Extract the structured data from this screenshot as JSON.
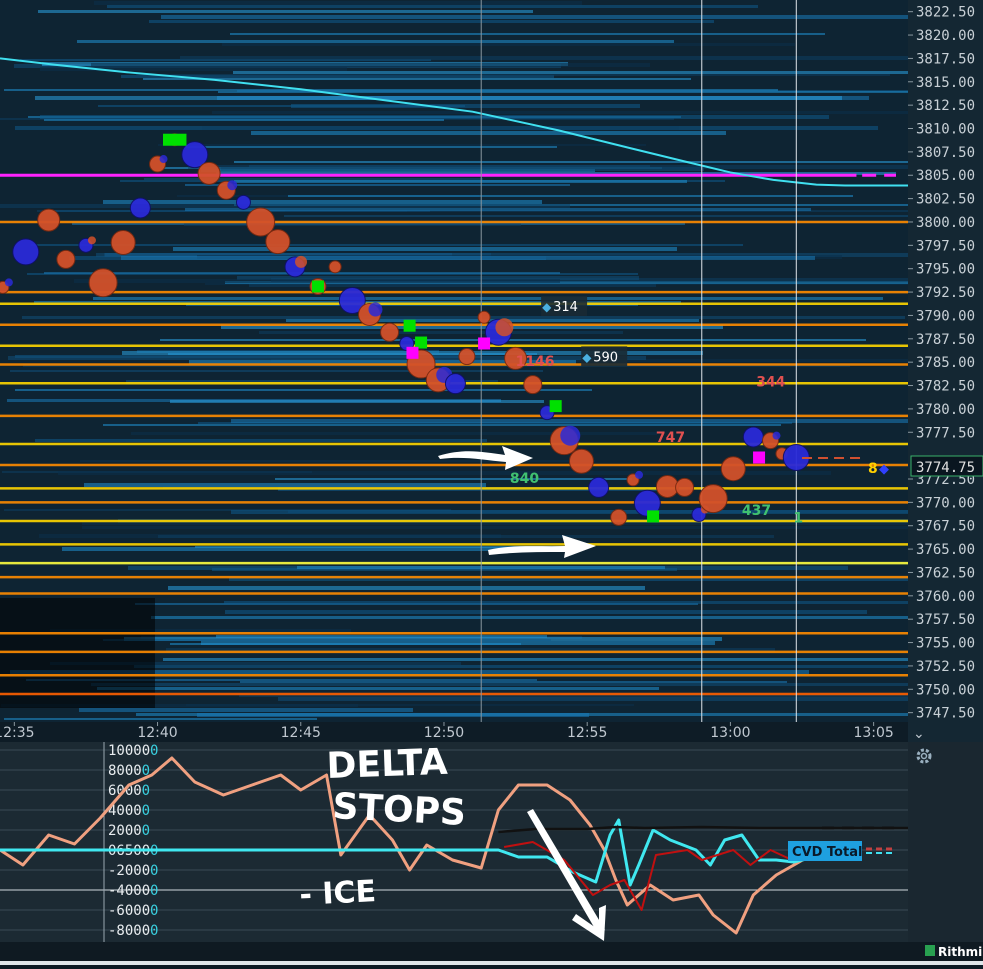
{
  "app": {
    "brand_label": "Rithmi",
    "settings_icon": "gear-icon",
    "collapse_icon": "chevron-down-icon"
  },
  "colors": {
    "background": "#0c1a24",
    "ask_bubble": "#d2512a",
    "bid_bubble": "#2a2ad8",
    "vwap_line": "#40e0f0",
    "magenta_level": "#ff22ff",
    "cvd_line": "#f0a080",
    "delta_line": "#40e8f0",
    "stops_line": "#c01010",
    "ice_line": "#111111",
    "annotation_ink": "#ffffff"
  },
  "chart_data": [
    {
      "type": "heatmap",
      "panel": "price",
      "xlabel": "",
      "ylabel": "",
      "x_ticks": [
        "12:35",
        "12:40",
        "12:45",
        "12:50",
        "12:55",
        "13:00",
        "13:05"
      ],
      "y_ticks": [
        "3822.50",
        "3820.00",
        "3817.50",
        "3815.00",
        "3812.50",
        "3810.00",
        "3807.50",
        "3805.00",
        "3802.50",
        "3800.00",
        "3797.50",
        "3795.00",
        "3792.50",
        "3790.00",
        "3787.50",
        "3785.00",
        "3782.50",
        "3780.00",
        "3777.50",
        "3774.75",
        "3772.50",
        "3770.00",
        "3767.50",
        "3765.00",
        "3762.50",
        "3760.00",
        "3757.50",
        "3755.00",
        "3752.50",
        "3750.00",
        "3747.50"
      ],
      "ylim": [
        3746.5,
        3823.75
      ],
      "xlim_minutes": [
        34.5,
        66.2
      ],
      "current_price": "3774.75",
      "current_price_marker": "8",
      "magenta_level": 3805.0,
      "vwap": {
        "name": "",
        "points": [
          [
            34.5,
            3817.5
          ],
          [
            36.5,
            3816.8
          ],
          [
            39,
            3816.0
          ],
          [
            42,
            3815.2
          ],
          [
            45,
            3814.2
          ],
          [
            48,
            3813.0
          ],
          [
            51,
            3811.8
          ],
          [
            54,
            3809.8
          ],
          [
            56.5,
            3807.9
          ],
          [
            58.5,
            3806.4
          ],
          [
            60,
            3805.3
          ],
          [
            61.5,
            3804.5
          ],
          [
            63,
            3804.0
          ],
          [
            64,
            3803.9
          ],
          [
            66.2,
            3803.9
          ]
        ]
      },
      "price_path": [
        [
          34.6,
          3793.0
        ],
        [
          35.4,
          3796.8
        ],
        [
          36.2,
          3800.2
        ],
        [
          36.8,
          3796.0
        ],
        [
          37.5,
          3797.5
        ],
        [
          38.1,
          3793.5
        ],
        [
          38.8,
          3797.8
        ],
        [
          39.4,
          3801.5
        ],
        [
          40.0,
          3806.2
        ],
        [
          40.6,
          3808.8
        ],
        [
          41.3,
          3807.2
        ],
        [
          41.8,
          3805.2
        ],
        [
          42.4,
          3803.4
        ],
        [
          43.0,
          3802.1
        ],
        [
          43.6,
          3800.0
        ],
        [
          44.2,
          3797.9
        ],
        [
          44.8,
          3795.2
        ],
        [
          45.6,
          3793.1
        ],
        [
          46.2,
          3795.2
        ],
        [
          46.8,
          3791.6
        ],
        [
          47.4,
          3790.1
        ],
        [
          48.1,
          3788.2
        ],
        [
          48.7,
          3787.0
        ],
        [
          49.2,
          3784.8
        ],
        [
          49.8,
          3783.1
        ],
        [
          50.4,
          3782.7
        ],
        [
          50.8,
          3785.6
        ],
        [
          51.4,
          3789.8
        ],
        [
          51.9,
          3788.2
        ],
        [
          52.5,
          3785.4
        ],
        [
          53.1,
          3782.6
        ],
        [
          53.6,
          3779.6
        ],
        [
          54.2,
          3776.6
        ],
        [
          54.8,
          3774.4
        ],
        [
          55.4,
          3771.6
        ],
        [
          56.1,
          3768.4
        ],
        [
          56.6,
          3772.4
        ],
        [
          57.1,
          3769.9
        ],
        [
          57.8,
          3771.7
        ],
        [
          58.4,
          3771.6
        ],
        [
          58.9,
          3768.7
        ],
        [
          59.4,
          3770.4
        ],
        [
          60.1,
          3773.6
        ],
        [
          60.8,
          3777.0
        ],
        [
          61.4,
          3776.6
        ],
        [
          61.8,
          3775.2
        ],
        [
          62.3,
          3774.8
        ]
      ],
      "trade_labels": [
        {
          "value": "314",
          "x": 53.6,
          "y": 3790.7,
          "color": "#ffffff",
          "icon": "diamond-icon"
        },
        {
          "value": "1146",
          "x": 52.5,
          "y": 3785.0,
          "color": "#e05050",
          "icon": ""
        },
        {
          "value": "590",
          "x": 55.0,
          "y": 3785.3,
          "color": "#ffffff",
          "icon": "diamond-icon"
        },
        {
          "value": "747",
          "x": 57.4,
          "y": 3776.9,
          "color": "#e05050",
          "icon": ""
        },
        {
          "value": "344",
          "x": 60.9,
          "y": 3782.8,
          "color": "#e05050",
          "icon": ""
        },
        {
          "value": "840",
          "x": 52.3,
          "y": 3772.5,
          "color": "#40c070",
          "icon": ""
        },
        {
          "value": "437",
          "x": 60.4,
          "y": 3769.1,
          "color": "#40c070",
          "icon": ""
        },
        {
          "value": "1",
          "x": 62.2,
          "y": 3768.3,
          "color": "#40c070",
          "icon": ""
        }
      ],
      "liquidity_levels": [
        {
          "price": 3800.0,
          "color": "#ff8c00"
        },
        {
          "price": 3792.5,
          "color": "#ff8c00"
        },
        {
          "price": 3791.25,
          "color": "#ffd700"
        },
        {
          "price": 3789.0,
          "color": "#ff8c00"
        },
        {
          "price": 3786.75,
          "color": "#ffd700"
        },
        {
          "price": 3784.75,
          "color": "#ff8c00"
        },
        {
          "price": 3782.75,
          "color": "#ffd700"
        },
        {
          "price": 3779.25,
          "color": "#ff8c00"
        },
        {
          "price": 3776.25,
          "color": "#ffd700"
        },
        {
          "price": 3774.0,
          "color": "#ff8c00"
        },
        {
          "price": 3771.5,
          "color": "#ffd700"
        },
        {
          "price": 3770.0,
          "color": "#ff8c00"
        },
        {
          "price": 3768.0,
          "color": "#ffd700"
        },
        {
          "price": 3765.5,
          "color": "#ffd700"
        },
        {
          "price": 3763.5,
          "color": "#ffff40"
        },
        {
          "price": 3762.0,
          "color": "#ff8c00"
        },
        {
          "price": 3760.25,
          "color": "#ff8c00"
        },
        {
          "price": 3756.0,
          "color": "#ff8c00"
        },
        {
          "price": 3754.0,
          "color": "#ff8c00"
        },
        {
          "price": 3751.5,
          "color": "#ff8c00"
        },
        {
          "price": 3749.5,
          "color": "#ff6000"
        }
      ]
    },
    {
      "type": "line",
      "panel": "cvd",
      "xlabel": "",
      "ylabel": "",
      "y_ticks": [
        "10000",
        "8000",
        "6000",
        "4000",
        "2000",
        "06500",
        "-2000",
        "-4000",
        "-6000",
        "-8000"
      ],
      "legend_label": "CVD Total",
      "series": [
        {
          "name": "",
          "points": [
            [
              34.5,
              0
            ],
            [
              35.3,
              -1500
            ],
            [
              36.2,
              1500
            ],
            [
              37.1,
              600
            ],
            [
              38.0,
              3200
            ],
            [
              39.0,
              6500
            ],
            [
              39.8,
              7500
            ],
            [
              40.5,
              9200
            ],
            [
              41.3,
              6800
            ],
            [
              42.3,
              5500
            ],
            [
              43.3,
              6500
            ],
            [
              44.3,
              7500
            ],
            [
              45.0,
              6000
            ],
            [
              45.9,
              7500
            ],
            [
              46.4,
              -500
            ],
            [
              47.4,
              3500
            ],
            [
              48.2,
              1000
            ],
            [
              48.8,
              -2000
            ],
            [
              49.4,
              500
            ],
            [
              50.3,
              -1000
            ],
            [
              51.3,
              -1800
            ],
            [
              51.9,
              4000
            ],
            [
              52.6,
              6500
            ],
            [
              53.6,
              6500
            ],
            [
              54.4,
              5000
            ],
            [
              55.1,
              2500
            ],
            [
              55.6,
              0
            ],
            [
              56.0,
              -3000
            ],
            [
              56.4,
              -5500
            ],
            [
              57.2,
              -3500
            ],
            [
              58.0,
              -5000
            ],
            [
              58.9,
              -4500
            ],
            [
              59.4,
              -6500
            ],
            [
              60.2,
              -8300
            ],
            [
              60.8,
              -4500
            ],
            [
              61.6,
              -2500
            ],
            [
              62.4,
              -1200
            ],
            [
              62.8,
              -500
            ]
          ]
        },
        {
          "name": "",
          "points": [
            [
              34.5,
              0
            ],
            [
              51.9,
              0
            ],
            [
              52.6,
              -700
            ],
            [
              53.6,
              -700
            ],
            [
              54.5,
              -2200
            ],
            [
              55.3,
              -3200
            ],
            [
              55.8,
              1500
            ],
            [
              56.1,
              3000
            ],
            [
              56.5,
              -3500
            ],
            [
              56.8,
              -1500
            ],
            [
              57.3,
              2000
            ],
            [
              57.9,
              1000
            ],
            [
              58.8,
              0
            ],
            [
              59.3,
              -1500
            ],
            [
              59.8,
              1000
            ],
            [
              60.4,
              1500
            ],
            [
              61.0,
              -1000
            ],
            [
              61.6,
              -1000
            ],
            [
              62.2,
              -1200
            ],
            [
              62.8,
              -800
            ]
          ]
        },
        {
          "name": "",
          "points": [
            [
              52.1,
              300
            ],
            [
              53.1,
              800
            ],
            [
              54.2,
              -1000
            ],
            [
              55.2,
              -4500
            ],
            [
              55.8,
              -3500
            ],
            [
              56.3,
              -3000
            ],
            [
              56.9,
              -6000
            ],
            [
              57.4,
              -500
            ],
            [
              58.5,
              0
            ],
            [
              59.0,
              -1000
            ],
            [
              60.1,
              0
            ],
            [
              60.7,
              -1500
            ],
            [
              61.4,
              0
            ],
            [
              62.0,
              -800
            ],
            [
              62.6,
              -200
            ]
          ]
        },
        {
          "name": "",
          "points": [
            [
              51.9,
              1800
            ],
            [
              53.2,
              2100
            ],
            [
              55.0,
              2100
            ],
            [
              56.0,
              2300
            ],
            [
              57.0,
              2200
            ],
            [
              59.0,
              2300
            ],
            [
              61.0,
              2200
            ],
            [
              63.0,
              2200
            ],
            [
              66.2,
              2200
            ]
          ]
        }
      ]
    }
  ],
  "annotations": {
    "delta": "DELTA",
    "stops": "STOPS",
    "ice": "- ICE"
  }
}
